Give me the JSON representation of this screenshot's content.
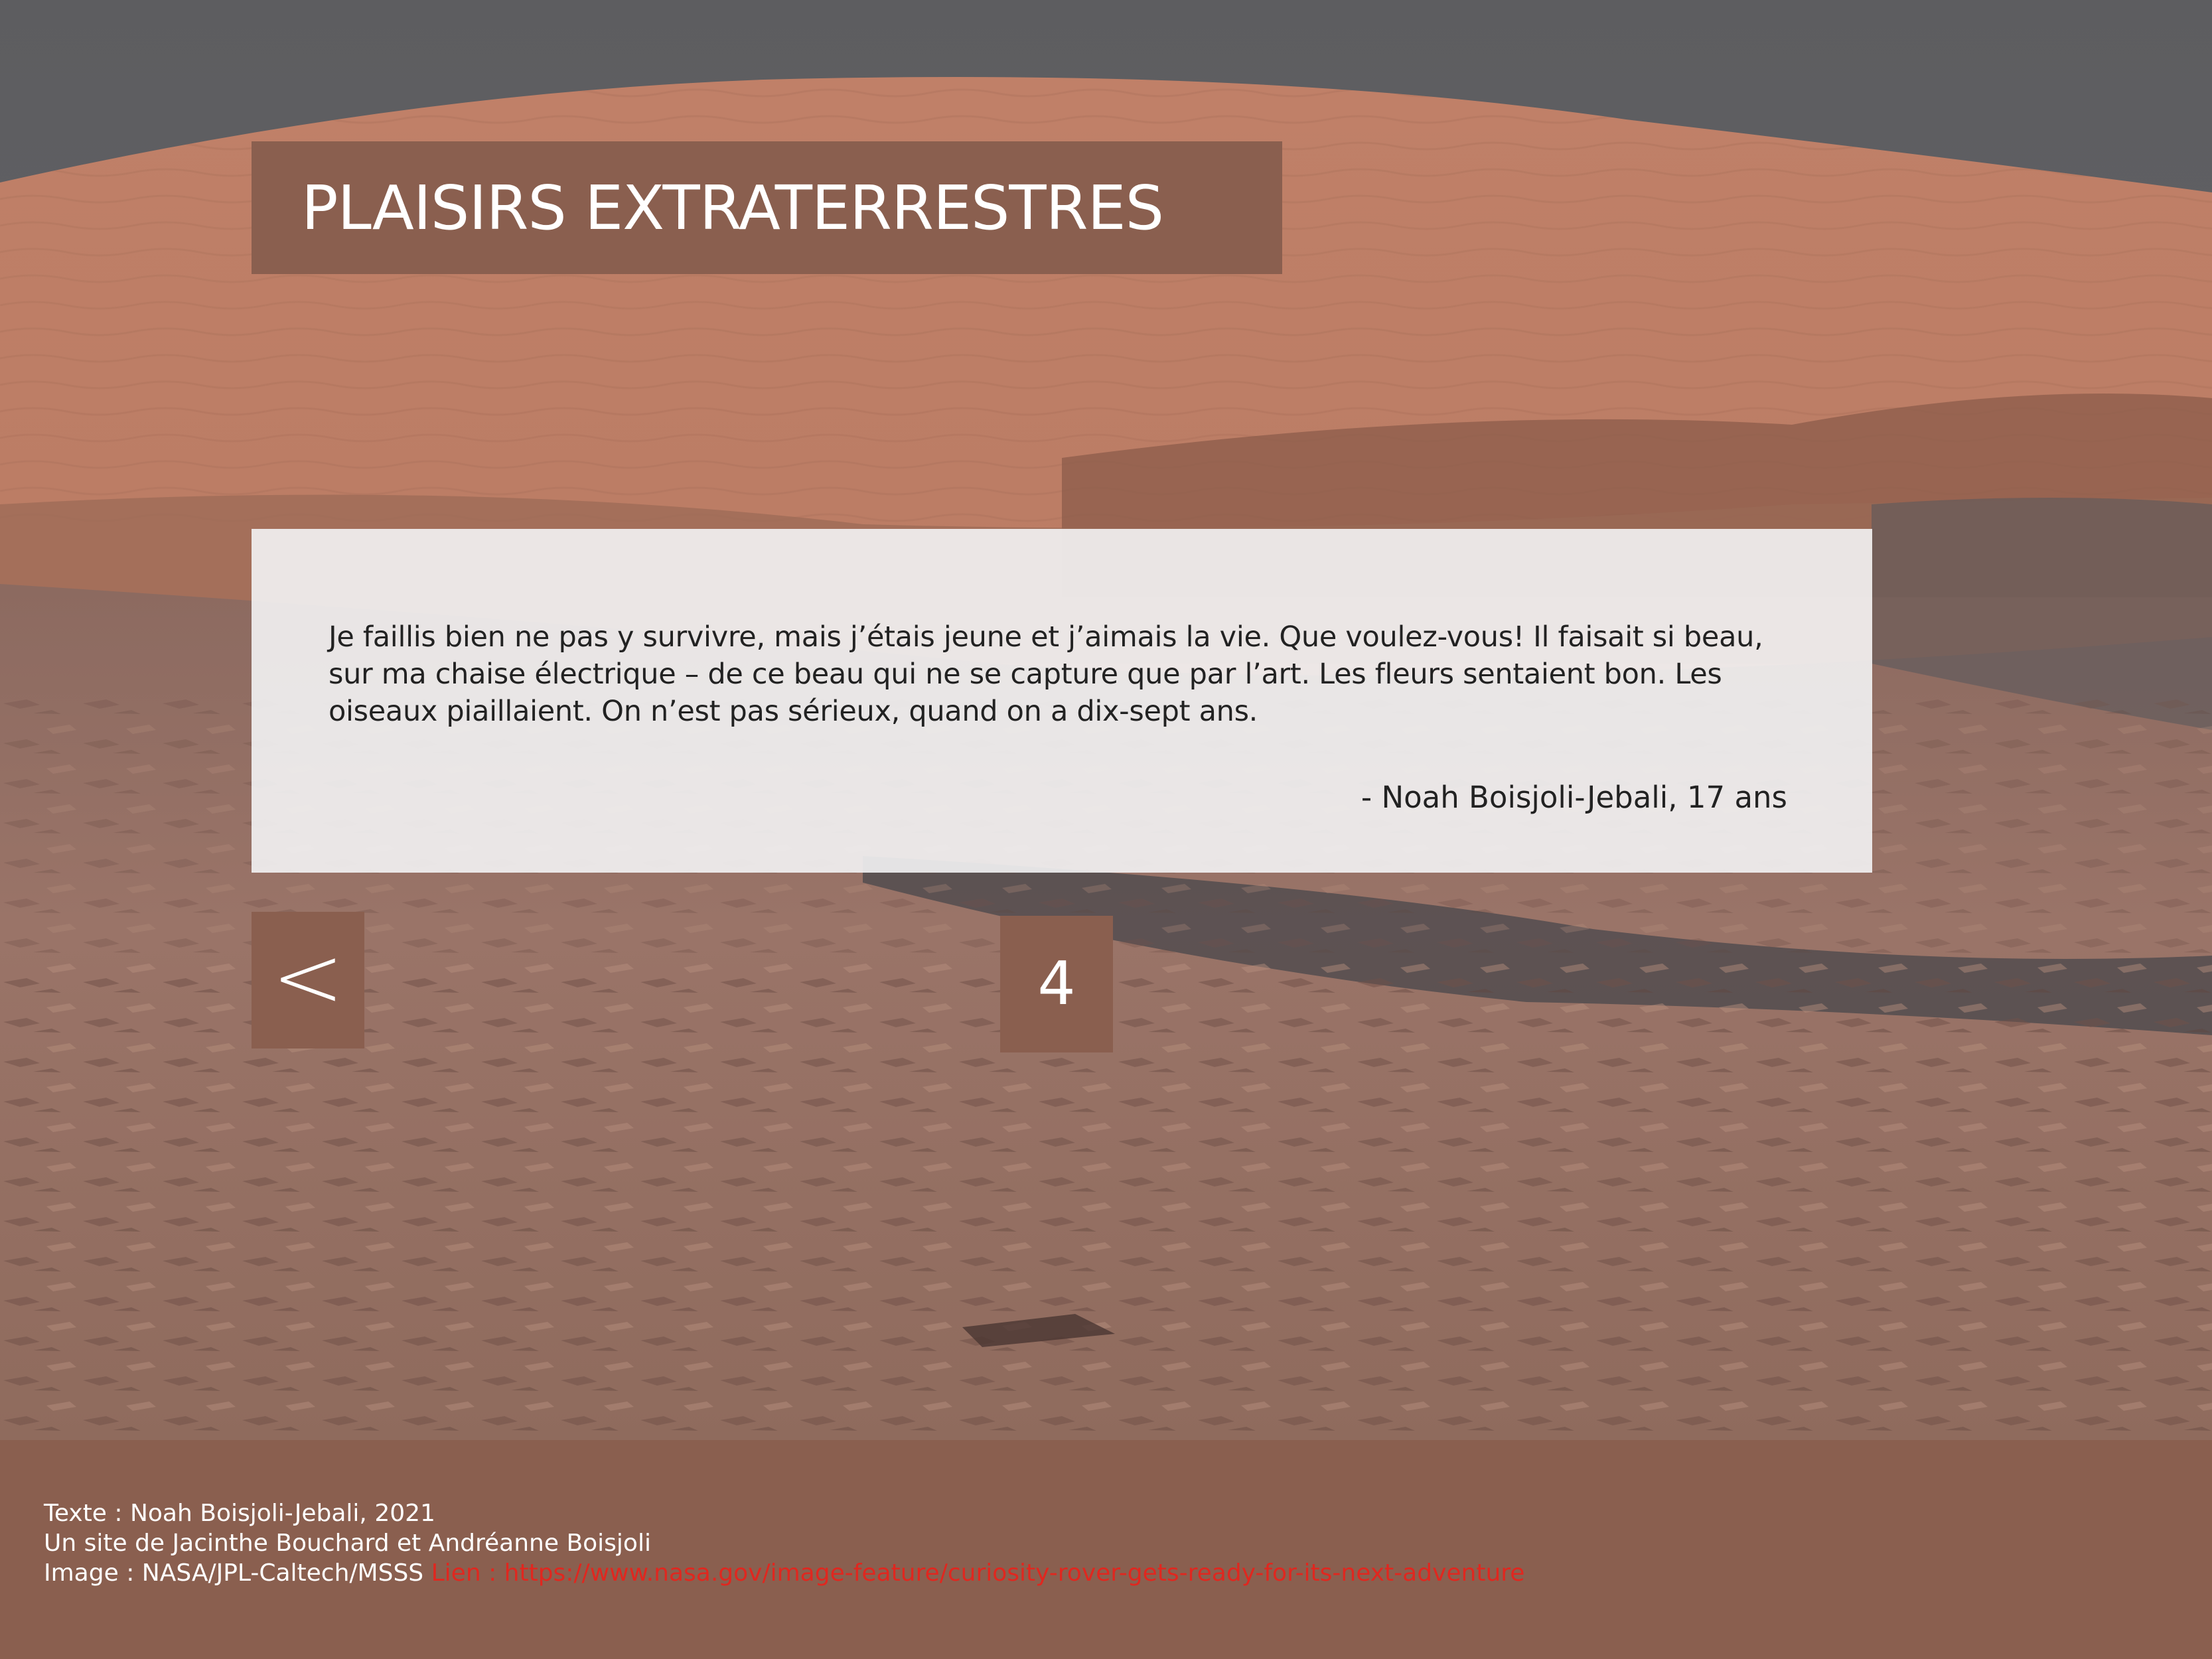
{
  "header": {
    "title": "PLAISIRS EXTRATERRESTRES"
  },
  "quote": {
    "text": "Je faillis bien ne pas y survivre, mais j’étais jeune et j’aimais la vie. Que voulez-vous! Il faisait si beau, sur ma chaise électrique – de ce beau qui ne se capture que par l’art. Les fleurs sentaient bon. Les oiseaux piaillaient. On n’est pas sérieux, quand on a dix-sept ans.",
    "author": "- Noah Boisjoli-Jebali, 17 ans"
  },
  "navigation": {
    "prev_label": "<",
    "page_number": "4"
  },
  "footer": {
    "text_credit": "Texte : Noah Boisjoli-Jebali, 2021",
    "site_credit": "Un site de Jacinthe Bouchard et Andréanne Boisjoli",
    "image_credit": "Image : NASA/JPL-Caltech/MSSS",
    "link_text": "Lien : https://www.nasa.gov/image-feature/curiosity-rover-gets-ready-for-its-next-adventure"
  },
  "colors": {
    "accent_brown": "#8a5f4f",
    "sky_gray": "#5d5d60",
    "link_red": "#e0271f"
  }
}
